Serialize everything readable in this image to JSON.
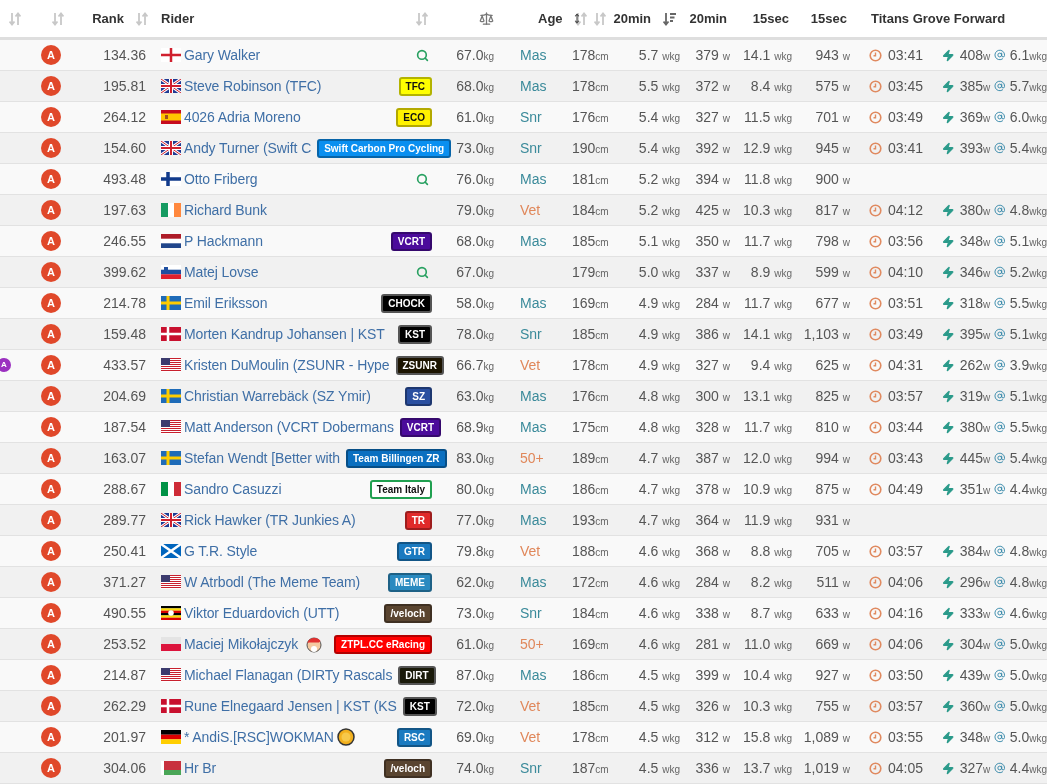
{
  "header": [
    {
      "kind": "blank",
      "sorted": false
    },
    {
      "kind": "blank",
      "sorted": false
    },
    {
      "kind": "text",
      "label": "Rank",
      "sorted": false
    },
    {
      "kind": "text",
      "label": "Rider",
      "sorted": false
    },
    {
      "kind": "scale"
    },
    {
      "kind": "text",
      "label": "Age",
      "sorted": false
    },
    {
      "kind": "height",
      "sorted": false
    },
    {
      "kind": "text",
      "label": "20min",
      "sorted": true
    },
    {
      "kind": "text",
      "label": "20min"
    },
    {
      "kind": "text",
      "label": "15sec"
    },
    {
      "kind": "text",
      "label": "15sec"
    },
    {
      "kind": "text",
      "label": "Titans Grove Forward"
    }
  ],
  "rows": [
    {
      "category": "A",
      "rank": "134.36",
      "flag": {
        "kind": "nir"
      },
      "name": "Gary Walker",
      "team": {
        "kind": "search"
      },
      "weight": "67.0kg",
      "age": {
        "text": "Mas",
        "color": "#3a8a9a"
      },
      "height": "178cm",
      "w20_wkg": "5.7 wkg",
      "w20": "379 w",
      "s15_wkg": "14.1 wkg",
      "s15": "943 w",
      "segment": {
        "time": "03:41",
        "watts": "408w",
        "wkg": "6.1wkg"
      }
    },
    {
      "category": "A",
      "rank": "195.81",
      "flag": {
        "kind": "gb"
      },
      "name": "Steve Robinson (TFC)",
      "team": {
        "kind": "badge",
        "label": "TFC",
        "color": "#ffff00"
      },
      "weight": "68.0kg",
      "age": {
        "text": "Mas",
        "color": "#3a8a9a"
      },
      "height": "178cm",
      "w20_wkg": "5.5 wkg",
      "w20": "372 w",
      "s15_wkg": "8.4 wkg",
      "s15": "575 w",
      "segment": {
        "time": "03:45",
        "watts": "385w",
        "wkg": "5.7wkg"
      }
    },
    {
      "category": "A",
      "rank": "264.12",
      "flag": {
        "kind": "es"
      },
      "name": "4026 Adria Moreno",
      "team": {
        "kind": "badge",
        "label": "ECO",
        "color": "#fff200"
      },
      "weight": "61.0kg",
      "age": {
        "text": "Snr",
        "color": "#3a8a9a"
      },
      "height": "176cm",
      "w20_wkg": "5.4 wkg",
      "w20": "327 w",
      "s15_wkg": "11.5 wkg",
      "s15": "701 w",
      "segment": {
        "time": "03:49",
        "watts": "369w",
        "wkg": "6.0wkg"
      }
    },
    {
      "category": "A",
      "rank": "154.60",
      "flag": {
        "kind": "gb"
      },
      "name": "Andy Turner (Swift C",
      "team": {
        "kind": "badge",
        "label": "Swift Carbon Pro Cycling",
        "color": "#0a8ff0"
      },
      "weight": "73.0kg",
      "age": {
        "text": "Snr",
        "color": "#3a8a9a"
      },
      "height": "190cm",
      "w20_wkg": "5.4 wkg",
      "w20": "392 w",
      "s15_wkg": "12.9 wkg",
      "s15": "945 w",
      "segment": {
        "time": "03:41",
        "watts": "393w",
        "wkg": "5.4wkg"
      }
    },
    {
      "category": "A",
      "rank": "493.48",
      "flag": {
        "kind": "fi"
      },
      "name": "Otto Friberg",
      "team": {
        "kind": "search"
      },
      "weight": "76.0kg",
      "age": {
        "text": "Mas",
        "color": "#3a8a9a"
      },
      "height": "181cm",
      "w20_wkg": "5.2 wkg",
      "w20": "394 w",
      "s15_wkg": "11.8 wkg",
      "s15": "900 w"
    },
    {
      "category": "A",
      "rank": "197.63",
      "flag": {
        "kind": "ie"
      },
      "name": "Richard Bunk",
      "weight": "79.0kg",
      "age": {
        "text": "Vet",
        "color": "#e0875a"
      },
      "height": "184cm",
      "w20_wkg": "5.2 wkg",
      "w20": "425 w",
      "s15_wkg": "10.3 wkg",
      "s15": "817 w",
      "segment": {
        "time": "04:12",
        "watts": "380w",
        "wkg": "4.8wkg"
      }
    },
    {
      "category": "A",
      "rank": "246.55",
      "flag": {
        "kind": "nl"
      },
      "name": "P Hackmann",
      "team": {
        "kind": "badge",
        "label": "VCRT",
        "color": "#4b0b9b"
      },
      "weight": "68.0kg",
      "age": {
        "text": "Mas",
        "color": "#3a8a9a"
      },
      "height": "185cm",
      "w20_wkg": "5.1 wkg",
      "w20": "350 w",
      "s15_wkg": "11.7 wkg",
      "s15": "798 w",
      "segment": {
        "time": "03:56",
        "watts": "348w",
        "wkg": "5.1wkg"
      }
    },
    {
      "category": "A",
      "rank": "399.62",
      "flag": {
        "kind": "si"
      },
      "name": "Matej Lovse",
      "team": {
        "kind": "search"
      },
      "weight": "67.0kg",
      "height": "179cm",
      "w20_wkg": "5.0 wkg",
      "w20": "337 w",
      "s15_wkg": "8.9 wkg",
      "s15": "599 w",
      "segment": {
        "time": "04:10",
        "watts": "346w",
        "wkg": "5.2wkg"
      }
    },
    {
      "category": "A",
      "rank": "214.78",
      "flag": {
        "kind": "se"
      },
      "name": "Emil Eriksson",
      "team": {
        "kind": "badge",
        "label": "CHOCK",
        "color": "#000000"
      },
      "weight": "58.0kg",
      "age": {
        "text": "Mas",
        "color": "#3a8a9a"
      },
      "height": "169cm",
      "w20_wkg": "4.9 wkg",
      "w20": "284 w",
      "s15_wkg": "11.7 wkg",
      "s15": "677 w",
      "segment": {
        "time": "03:51",
        "watts": "318w",
        "wkg": "5.5wkg"
      }
    },
    {
      "category": "A",
      "rank": "159.48",
      "flag": {
        "kind": "dk"
      },
      "name": "Morten Kandrup Johansen | KST",
      "team": {
        "kind": "badge",
        "label": "KST",
        "color": "#000000"
      },
      "weight": "78.0kg",
      "age": {
        "text": "Snr",
        "color": "#3a8a9a"
      },
      "height": "185cm",
      "w20_wkg": "4.9 wkg",
      "w20": "386 w",
      "s15_wkg": "14.1 wkg",
      "s15": "1,103 w",
      "segment": {
        "time": "03:49",
        "watts": "395w",
        "wkg": "5.1wkg"
      }
    },
    {
      "category": "A",
      "marker": "A",
      "rank": "433.57",
      "flag": {
        "kind": "us"
      },
      "name": "Kristen DuMoulin (ZSUNR - Hype",
      "team": {
        "kind": "badge",
        "label": "ZSUNR",
        "color": "#1c1400"
      },
      "weight": "66.7kg",
      "age": {
        "text": "Vet",
        "color": "#e0875a"
      },
      "height": "178cm",
      "w20_wkg": "4.9 wkg",
      "w20": "327 w",
      "s15_wkg": "9.4 wkg",
      "s15": "625 w",
      "segment": {
        "time": "04:31",
        "watts": "262w",
        "wkg": "3.9wkg"
      }
    },
    {
      "category": "A",
      "rank": "204.69",
      "flag": {
        "kind": "se"
      },
      "name": "Christian Warrebäck (SZ Ymir)",
      "team": {
        "kind": "badge",
        "label": "SZ",
        "color": "#2a4fa0"
      },
      "weight": "63.0kg",
      "age": {
        "text": "Mas",
        "color": "#3a8a9a"
      },
      "height": "176cm",
      "w20_wkg": "4.8 wkg",
      "w20": "300 w",
      "s15_wkg": "13.1 wkg",
      "s15": "825 w",
      "segment": {
        "time": "03:57",
        "watts": "319w",
        "wkg": "5.1wkg"
      }
    },
    {
      "category": "A",
      "rank": "187.54",
      "flag": {
        "kind": "us"
      },
      "name": "Matt Anderson (VCRT Dobermans",
      "team": {
        "kind": "badge",
        "label": "VCRT",
        "color": "#4b0b9b"
      },
      "weight": "68.9kg",
      "age": {
        "text": "Mas",
        "color": "#3a8a9a"
      },
      "height": "175cm",
      "w20_wkg": "4.8 wkg",
      "w20": "328 w",
      "s15_wkg": "11.7 wkg",
      "s15": "810 w",
      "segment": {
        "time": "03:44",
        "watts": "380w",
        "wkg": "5.5wkg"
      }
    },
    {
      "category": "A",
      "rank": "163.07",
      "flag": {
        "kind": "se"
      },
      "name": "Stefan Wendt [Better with",
      "team": {
        "kind": "badge",
        "label": "Team Billingen ZR",
        "color": "#0a6fc0"
      },
      "weight": "83.0kg",
      "age": {
        "text": "50+",
        "color": "#e0875a"
      },
      "height": "189cm",
      "w20_wkg": "4.7 wkg",
      "w20": "387 w",
      "s15_wkg": "12.0 wkg",
      "s15": "994 w",
      "segment": {
        "time": "03:43",
        "watts": "445w",
        "wkg": "5.4wkg"
      }
    },
    {
      "category": "A",
      "rank": "288.67",
      "flag": {
        "kind": "it"
      },
      "name": "Sandro Casuzzi",
      "team": {
        "kind": "badge",
        "label": "Team Italy",
        "color": "#ffffff"
      },
      "weight": "80.0kg",
      "age": {
        "text": "Mas",
        "color": "#3a8a9a"
      },
      "height": "186cm",
      "w20_wkg": "4.7 wkg",
      "w20": "378 w",
      "s15_wkg": "10.9 wkg",
      "s15": "875 w",
      "segment": {
        "time": "04:49",
        "watts": "351w",
        "wkg": "4.4wkg"
      }
    },
    {
      "category": "A",
      "rank": "289.77",
      "flag": {
        "kind": "gb"
      },
      "name": "Rick Hawker (TR Junkies A)",
      "team": {
        "kind": "badge",
        "label": "TR",
        "color": "#e02a2a"
      },
      "weight": "77.0kg",
      "age": {
        "text": "Mas",
        "color": "#3a8a9a"
      },
      "height": "193cm",
      "w20_wkg": "4.7 wkg",
      "w20": "364 w",
      "s15_wkg": "11.9 wkg",
      "s15": "931 w"
    },
    {
      "category": "A",
      "rank": "250.41",
      "flag": {
        "kind": "sct"
      },
      "name": "G T.R. Style",
      "team": {
        "kind": "badge",
        "label": "GTR",
        "color": "#1a7ac0"
      },
      "weight": "79.8kg",
      "age": {
        "text": "Vet",
        "color": "#e0875a"
      },
      "height": "188cm",
      "w20_wkg": "4.6 wkg",
      "w20": "368 w",
      "s15_wkg": "8.8 wkg",
      "s15": "705 w",
      "segment": {
        "time": "03:57",
        "watts": "384w",
        "wkg": "4.8wkg"
      }
    },
    {
      "category": "A",
      "rank": "371.27",
      "flag": {
        "kind": "us"
      },
      "name": "W Atrbodl (The Meme Team)",
      "team": {
        "kind": "badge",
        "label": "MEME",
        "color": "#2a8ac0"
      },
      "weight": "62.0kg",
      "age": {
        "text": "Mas",
        "color": "#3a8a9a"
      },
      "height": "172cm",
      "w20_wkg": "4.6 wkg",
      "w20": "284 w",
      "s15_wkg": "8.2 wkg",
      "s15": "511 w",
      "segment": {
        "time": "04:06",
        "watts": "296w",
        "wkg": "4.8wkg"
      }
    },
    {
      "category": "A",
      "rank": "490.55",
      "flag": {
        "kind": "ug"
      },
      "name": "Viktor Eduardovich (UTT)",
      "team": {
        "kind": "badge",
        "label": "/veloch",
        "color": "#5a4530"
      },
      "weight": "73.0kg",
      "age": {
        "text": "Snr",
        "color": "#3a8a9a"
      },
      "height": "184cm",
      "w20_wkg": "4.6 wkg",
      "w20": "338 w",
      "s15_wkg": "8.7 wkg",
      "s15": "633 w",
      "segment": {
        "time": "04:16",
        "watts": "333w",
        "wkg": "4.6wkg"
      }
    },
    {
      "category": "A",
      "rank": "253.52",
      "flag": {
        "kind": "pl"
      },
      "name": "Maciej Mikołajczyk",
      "name_icon": {
        "kind": "santa"
      },
      "team": {
        "kind": "badge",
        "label": "ZTPL.CC eRacing",
        "color": "#ff0000"
      },
      "weight": "61.0kg",
      "age": {
        "text": "50+",
        "color": "#e0875a"
      },
      "height": "169cm",
      "w20_wkg": "4.6 wkg",
      "w20": "281 w",
      "s15_wkg": "11.0 wkg",
      "s15": "669 w",
      "segment": {
        "time": "04:06",
        "watts": "304w",
        "wkg": "5.0wkg"
      }
    },
    {
      "category": "A",
      "rank": "214.87",
      "flag": {
        "kind": "us"
      },
      "name": "Michael Flanagan (DIRTy Rascals",
      "team": {
        "kind": "badge",
        "label": "DIRT",
        "color": "#1a1a0a"
      },
      "weight": "87.0kg",
      "age": {
        "text": "Mas",
        "color": "#3a8a9a"
      },
      "height": "186cm",
      "w20_wkg": "4.5 wkg",
      "w20": "399 w",
      "s15_wkg": "10.4 wkg",
      "s15": "927 w",
      "segment": {
        "time": "03:50",
        "watts": "439w",
        "wkg": "5.0wkg"
      }
    },
    {
      "category": "A",
      "rank": "262.29",
      "flag": {
        "kind": "dk"
      },
      "name": "Rune Elnegaard Jensen | KST (KS",
      "team": {
        "kind": "badge",
        "label": "KST",
        "color": "#000000"
      },
      "weight": "72.0kg",
      "age": {
        "text": "Vet",
        "color": "#e0875a"
      },
      "height": "185cm",
      "w20_wkg": "4.5 wkg",
      "w20": "326 w",
      "s15_wkg": "10.3 wkg",
      "s15": "755 w",
      "segment": {
        "time": "03:57",
        "watts": "360w",
        "wkg": "5.0wkg"
      }
    },
    {
      "category": "A",
      "rank": "201.97",
      "flag": {
        "kind": "de"
      },
      "name": "* AndiS.[RSC]WOKMAN",
      "name_icon": {
        "kind": "coin"
      },
      "team": {
        "kind": "badge",
        "label": "RSC",
        "color": "#1a7ac0"
      },
      "weight": "69.0kg",
      "age": {
        "text": "Vet",
        "color": "#e0875a"
      },
      "height": "178cm",
      "w20_wkg": "4.5 wkg",
      "w20": "312 w",
      "s15_wkg": "15.8 wkg",
      "s15": "1,089 w",
      "segment": {
        "time": "03:55",
        "watts": "348w",
        "wkg": "5.0wkg"
      }
    },
    {
      "category": "A",
      "rank": "304.06",
      "flag": {
        "kind": "by"
      },
      "name": "Hr Br",
      "team": {
        "kind": "badge",
        "label": "/veloch",
        "color": "#5a4530"
      },
      "weight": "74.0kg",
      "age": {
        "text": "Snr",
        "color": "#3a8a9a"
      },
      "height": "187cm",
      "w20_wkg": "4.5 wkg",
      "w20": "336 w",
      "s15_wkg": "13.7 wkg",
      "s15": "1,019 w",
      "segment": {
        "time": "04:05",
        "watts": "327w",
        "wkg": "4.4wkg"
      }
    }
  ]
}
